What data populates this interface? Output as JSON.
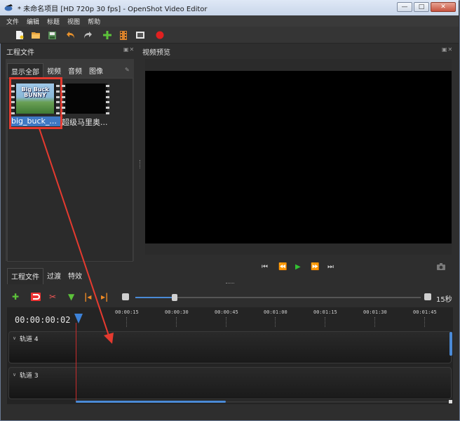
{
  "window": {
    "title": "* 未命名项目 [HD 720p 30 fps] - OpenShot Video Editor",
    "min_glyph": "—",
    "max_glyph": "□",
    "close_glyph": "✕"
  },
  "menu": [
    "文件",
    "编辑",
    "标题",
    "视图",
    "帮助"
  ],
  "toolbar_icons": [
    "new-project-icon",
    "open-project-icon",
    "save-project-icon",
    "undo-icon",
    "redo-icon",
    "import-files-icon",
    "profile-icon",
    "fullscreen-icon",
    "export-video-icon"
  ],
  "project_files": {
    "title": "工程文件",
    "filter_tabs": [
      "显示全部",
      "视频",
      "音频",
      "图像"
    ],
    "items": [
      {
        "label": "big_buck_...",
        "thumb_text": "Big Buck BUNNY"
      },
      {
        "label": "超级马里奥..."
      }
    ],
    "bottom_tabs": [
      "工程文件",
      "过渡",
      "特效"
    ]
  },
  "preview": {
    "title": "视频预览",
    "controls": [
      "jump-start-icon",
      "rewind-icon",
      "play-icon",
      "fast-forward-icon",
      "jump-end-icon"
    ]
  },
  "timeline": {
    "zoom_label": "15秒",
    "zoom_level_fraction": 0.13,
    "timecode": "00:00:00:02",
    "ruler": [
      "00:00:15",
      "00:00:30",
      "00:00:45",
      "00:01:00",
      "00:01:15",
      "00:01:30",
      "00:01:45"
    ],
    "tracks": [
      "轨道 4",
      "轨道 3"
    ],
    "scroll_fraction": 0.4
  },
  "colors": {
    "accent": "#4a8ad6",
    "annotation": "#e53a2f",
    "playhead": "#c92c2c",
    "selection": "#3f79c4"
  }
}
